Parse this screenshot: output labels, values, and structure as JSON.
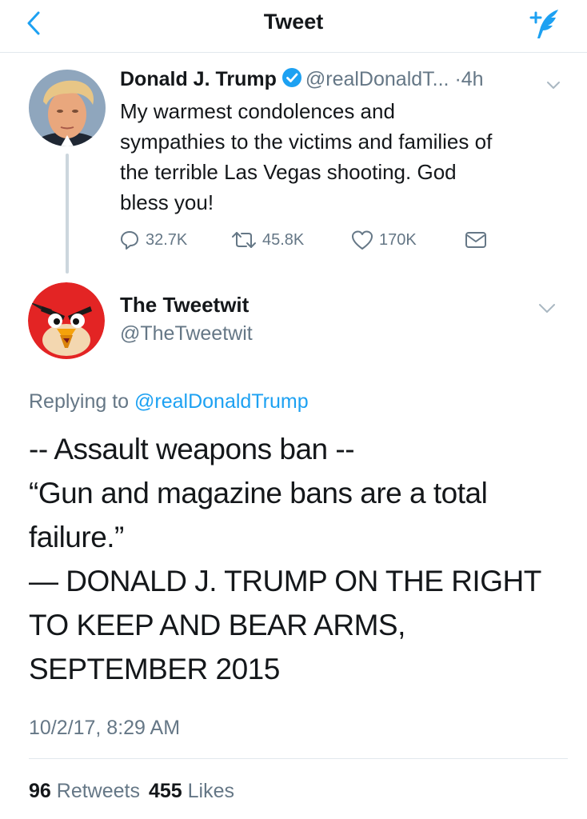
{
  "navbar": {
    "title": "Tweet"
  },
  "tweet1": {
    "name": "Donald J. Trump",
    "handle": "@realDonaldT...",
    "dot": "·",
    "time": "4h",
    "text_lines": [
      "My warmest condolences and",
      "sympathies to the victims and families of",
      "the terrible Las Vegas shooting. God",
      "bless you!"
    ],
    "actions": {
      "replies": "32.7K",
      "retweets": "45.8K",
      "likes": "170K"
    }
  },
  "tweet2": {
    "name": "The Tweetwit",
    "handle": "@TheTweetwit",
    "replying_prefix": "Replying to ",
    "replying_handle": "@realDonaldTrump",
    "text_lines": [
      "-- Assault weapons ban --",
      "“Gun and magazine bans are a total",
      "failure.”",
      "— DONALD J. TRUMP ON THE RIGHT",
      "TO KEEP AND BEAR ARMS,",
      "SEPTEMBER 2015"
    ],
    "date": "10/2/17, 8:29 AM",
    "retweet_count": "96",
    "retweet_label": "Retweets",
    "like_count": "455",
    "like_label": "Likes"
  },
  "colors": {
    "accent": "#1da1f2",
    "secondary_text": "#657786",
    "primary_text": "#14171a",
    "divider": "#e1e8ed"
  },
  "icons": [
    "back-chevron-icon",
    "compose-tweet-icon",
    "verified-badge-icon",
    "caret-down-icon",
    "reply-icon",
    "retweet-icon",
    "like-heart-icon",
    "direct-message-icon"
  ]
}
